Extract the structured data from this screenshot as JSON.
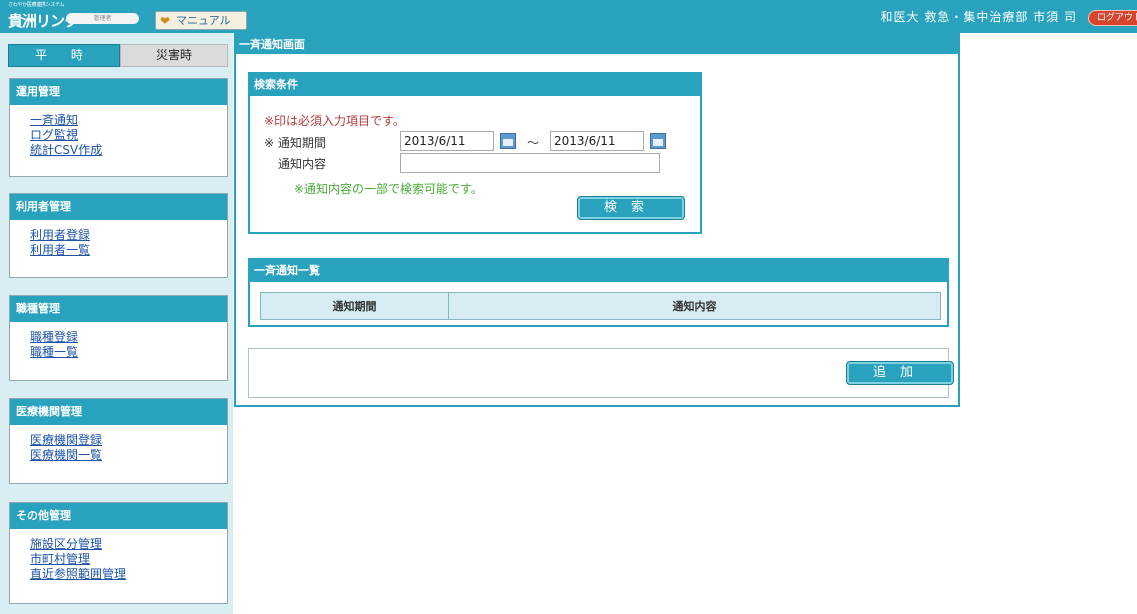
{
  "header": {
    "logo_small": "さわやか医療連携システム",
    "logo_main": "貴洲リンク",
    "role_badge": "管理者",
    "manual_label": "マニュアル",
    "user_info": "和医大 救急・集中治療部 市須 司",
    "logout_label": "ログアウト"
  },
  "sidebar": {
    "tabs": [
      {
        "label": "平 時",
        "active": true
      },
      {
        "label": "災害時",
        "active": false
      }
    ],
    "sections": [
      {
        "title": "運用管理",
        "items": [
          "一斉通知",
          "ログ監視",
          "統計CSV作成"
        ]
      },
      {
        "title": "利用者管理",
        "items": [
          "利用者登録",
          "利用者一覧"
        ]
      },
      {
        "title": "職種管理",
        "items": [
          "職種登録",
          "職種一覧"
        ]
      },
      {
        "title": "医療機関管理",
        "items": [
          "医療機関登録",
          "医療機関一覧"
        ]
      },
      {
        "title": "その他管理",
        "items": [
          "施設区分管理",
          "市町村管理",
          "直近参照範囲管理"
        ]
      }
    ]
  },
  "main": {
    "title": "一斉通知画面",
    "search": {
      "heading": "検索条件",
      "required_note": "※印は必須入力項目です。",
      "period_label": "※ 通知期間",
      "date_from": "2013/6/11",
      "tilde": "～",
      "date_to": "2013/6/11",
      "content_label": "通知内容",
      "content_value": "",
      "partial_note": "※通知内容の一部で検索可能です。",
      "search_button": "検索"
    },
    "list": {
      "heading": "一斉通知一覧",
      "columns": [
        "通知期間",
        "通知内容"
      ]
    },
    "add_button": "追加"
  },
  "colors": {
    "accent": "#29a3bd",
    "sidebar_bg": "#d8eef2",
    "link": "#1f54a8",
    "required": "#b13a3a",
    "hint": "#4caa3a",
    "logout": "#d8452e"
  }
}
